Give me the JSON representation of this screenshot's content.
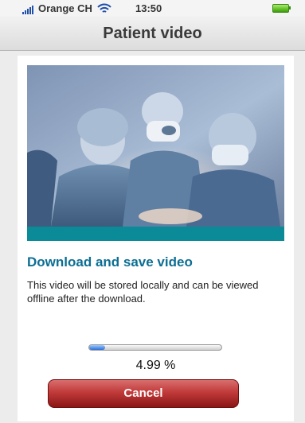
{
  "status_bar": {
    "carrier": "Orange CH",
    "time": "13:50",
    "signal_icon": "signal-bars-icon",
    "wifi_icon": "wifi-icon",
    "battery_icon": "battery-icon",
    "signal_color": "#1f4fa8",
    "battery_color": "#62c223"
  },
  "nav": {
    "title": "Patient video"
  },
  "content": {
    "image_semantic": "surgeons-operating-image",
    "accent_color": "#0b8a97",
    "heading": "Download and save video",
    "heading_color": "#0c6e93",
    "description": "This video will be stored locally and can be viewed offline after the download.",
    "progress": {
      "value_percent": 4.99,
      "label": "4.99 %"
    },
    "cancel_label": "Cancel",
    "cancel_color": "#c13a3a"
  }
}
